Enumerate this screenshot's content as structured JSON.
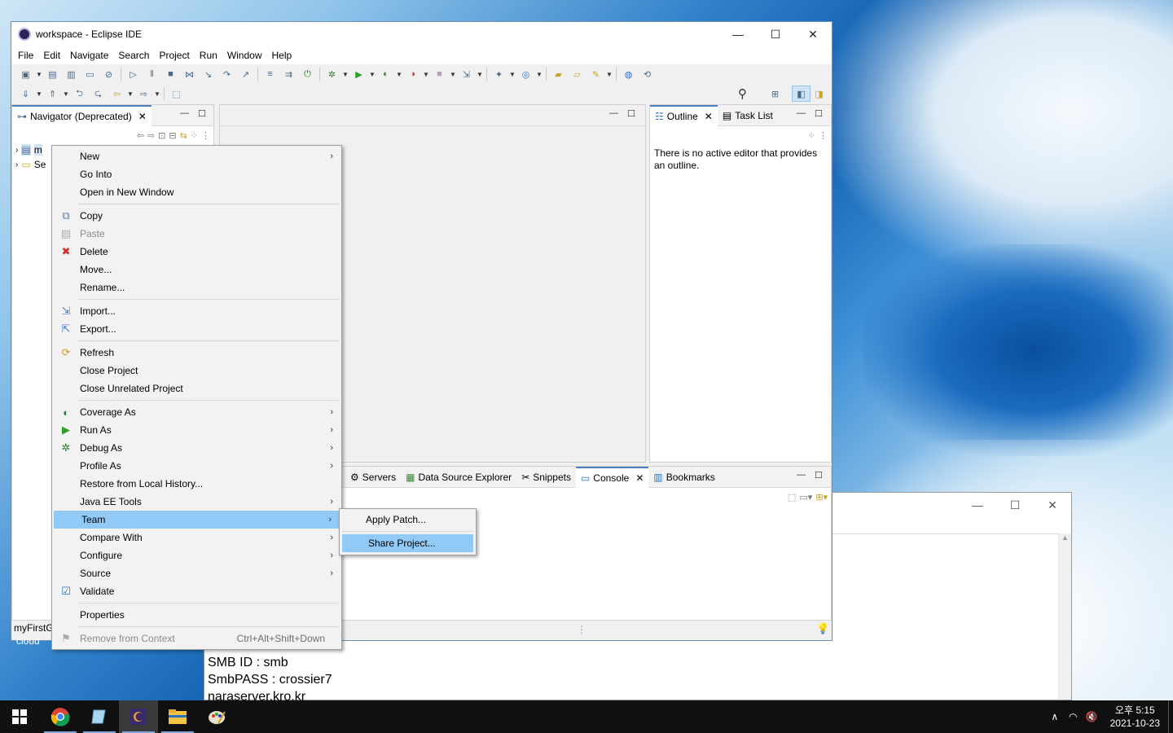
{
  "window": {
    "title": "workspace - Eclipse IDE",
    "controls": {
      "minimize": "—",
      "maximize": "☐",
      "close": "✕"
    }
  },
  "menubar": [
    "File",
    "Edit",
    "Navigate",
    "Search",
    "Project",
    "Run",
    "Window",
    "Help"
  ],
  "navigator": {
    "tab_label": "Navigator (Deprecated)",
    "tree": [
      {
        "label": "m",
        "icon": "project-folder-icon"
      },
      {
        "label": "Se",
        "icon": "folder-icon"
      }
    ],
    "status": "myFirstG"
  },
  "outline": {
    "tabs": [
      {
        "label": "Outline",
        "icon": "outline-icon"
      },
      {
        "label": "Task List",
        "icon": "task-list-icon"
      }
    ],
    "message": "There is no active editor that provides an outline."
  },
  "bottom_tabs": [
    {
      "label": "Servers",
      "icon": "servers-icon"
    },
    {
      "label": "Data Source Explorer",
      "icon": "data-source-icon"
    },
    {
      "label": "Snippets",
      "icon": "snippets-icon"
    },
    {
      "label": "Console",
      "icon": "console-icon",
      "active": true
    },
    {
      "label": "Bookmarks",
      "icon": "bookmarks-icon"
    }
  ],
  "context_menu": [
    {
      "label": "New",
      "submenu": true
    },
    {
      "label": "Go Into"
    },
    {
      "label": "Open in New Window"
    },
    {
      "sep": true
    },
    {
      "label": "Copy",
      "icon": "copy-icon"
    },
    {
      "label": "Paste",
      "icon": "paste-icon",
      "disabled": true
    },
    {
      "label": "Delete",
      "icon": "delete-icon"
    },
    {
      "label": "Move..."
    },
    {
      "label": "Rename..."
    },
    {
      "sep": true
    },
    {
      "label": "Import...",
      "icon": "import-icon"
    },
    {
      "label": "Export...",
      "icon": "export-icon"
    },
    {
      "sep": true
    },
    {
      "label": "Refresh",
      "icon": "refresh-icon"
    },
    {
      "label": "Close Project"
    },
    {
      "label": "Close Unrelated Project"
    },
    {
      "sep": true
    },
    {
      "label": "Coverage As",
      "icon": "coverage-icon",
      "submenu": true
    },
    {
      "label": "Run As",
      "icon": "run-icon",
      "submenu": true
    },
    {
      "label": "Debug As",
      "icon": "debug-icon",
      "submenu": true
    },
    {
      "label": "Profile As",
      "submenu": true
    },
    {
      "label": "Restore from Local History..."
    },
    {
      "label": "Java EE Tools",
      "submenu": true
    },
    {
      "label": "Team",
      "submenu": true,
      "highlighted": true
    },
    {
      "label": "Compare With",
      "submenu": true
    },
    {
      "label": "Configure",
      "submenu": true
    },
    {
      "label": "Source",
      "submenu": true
    },
    {
      "label": "Validate",
      "icon": "checkbox-checked-icon"
    },
    {
      "sep": true
    },
    {
      "label": "Properties"
    },
    {
      "sep": true
    },
    {
      "label": "Remove from Context",
      "shortcut": "Ctrl+Alt+Shift+Down",
      "disabled": true,
      "icon": "remove-context-icon"
    }
  ],
  "team_submenu": [
    {
      "label": "Apply Patch..."
    },
    {
      "label": "Share Project...",
      "highlighted": true
    }
  ],
  "background_window": {
    "lines": [
      "SMB ID : smb",
      "SmbPASS : crossier7",
      "naraserver.kro.kr"
    ]
  },
  "desktop_labels": {
    "cloud": "cloud"
  },
  "taskbar": {
    "apps": [
      "chrome-icon",
      "notepad-icon",
      "eclipse-icon",
      "file-explorer-icon",
      "paint-icon"
    ],
    "time": "오후 5:15",
    "date": "2021-10-23"
  }
}
